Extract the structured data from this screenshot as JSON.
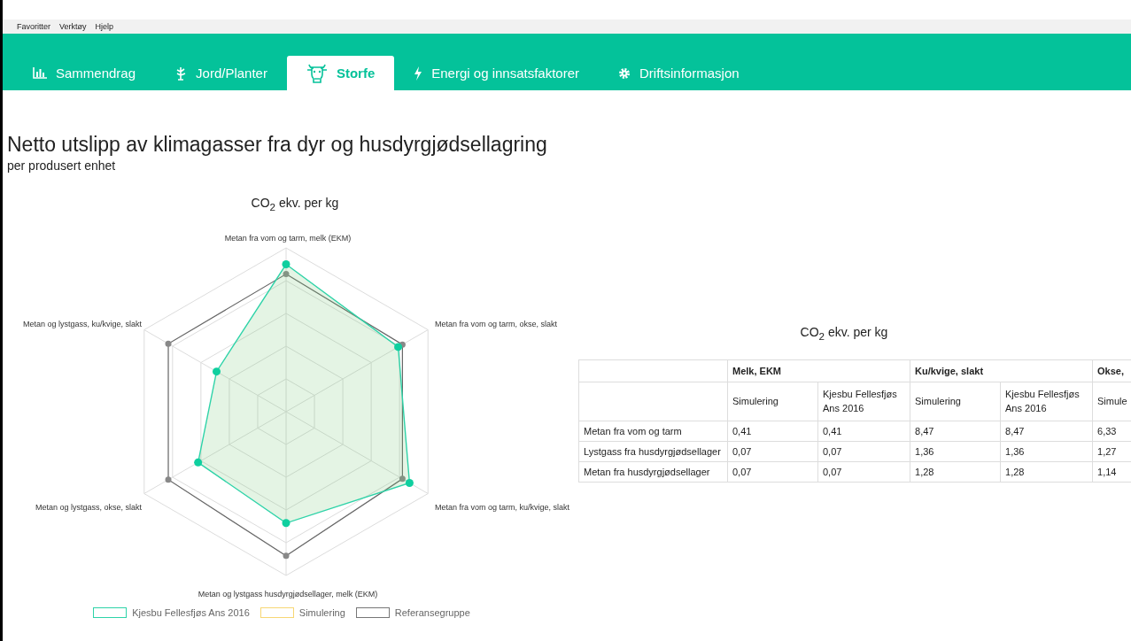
{
  "menu_bar": [
    "Favoritter",
    "Verktøy",
    "Hjelp"
  ],
  "tabs": [
    {
      "label": "Sammendrag",
      "kind": "chart",
      "selected": false
    },
    {
      "label": "Jord/Planter",
      "kind": "plant",
      "selected": false
    },
    {
      "label": "Storfe",
      "kind": "cow",
      "selected": true
    },
    {
      "label": "Energi og innsatsfaktorer",
      "kind": "bolt",
      "selected": false
    },
    {
      "label": "Driftsinformasjon",
      "kind": "gear",
      "selected": false
    }
  ],
  "heading": "Netto utslipp av klimagasser fra dyr og husdyrgjødsellagring",
  "subheading": "per produsert enhet",
  "radar": {
    "title": "CO$_{2}$ ekv. per kg",
    "axes": [
      "Metan fra vom og tarm, melk (EKM)",
      "Metan og lystgass, ku/kvige, slakt",
      "Metan fra vom og tarm, okse, slakt",
      "Metan og lystgass, okse, slakt",
      "Metan fra vom og tarm, ku/kvige, slakt",
      "Metan og lystgass husdyrgjødsellager, melk (EKM)"
    ],
    "legend": [
      {
        "label": "Kjesbu Fellesfjøs Ans 2016",
        "color": "#2ed3a8"
      },
      {
        "label": "Simulering",
        "color": "#f7d774"
      },
      {
        "label": "Referansegruppe",
        "color": "#777777"
      }
    ]
  },
  "table": {
    "title": "CO$_{2}$ ekv. per kg",
    "groups": [
      "Melk, EKM",
      "Ku/kvige, slakt",
      "Okse,"
    ],
    "subcolumns": [
      "Simulering",
      "Kjesbu Fellesfjøs Ans 2016",
      "Simulering",
      "Kjesbu Fellesfjøs Ans 2016",
      "Simule"
    ],
    "rows": [
      {
        "label": "Metan fra vom og tarm",
        "values": [
          "0,41",
          "0,41",
          "8,47",
          "8,47",
          "6,33"
        ]
      },
      {
        "label": "Lystgass fra husdyrgjødsellager",
        "values": [
          "0,07",
          "0,07",
          "1,36",
          "1,36",
          "1,27"
        ]
      },
      {
        "label": "Metan fra husdyrgjødsellager",
        "values": [
          "0,07",
          "0,07",
          "1,28",
          "1,28",
          "1,14"
        ]
      }
    ]
  }
}
